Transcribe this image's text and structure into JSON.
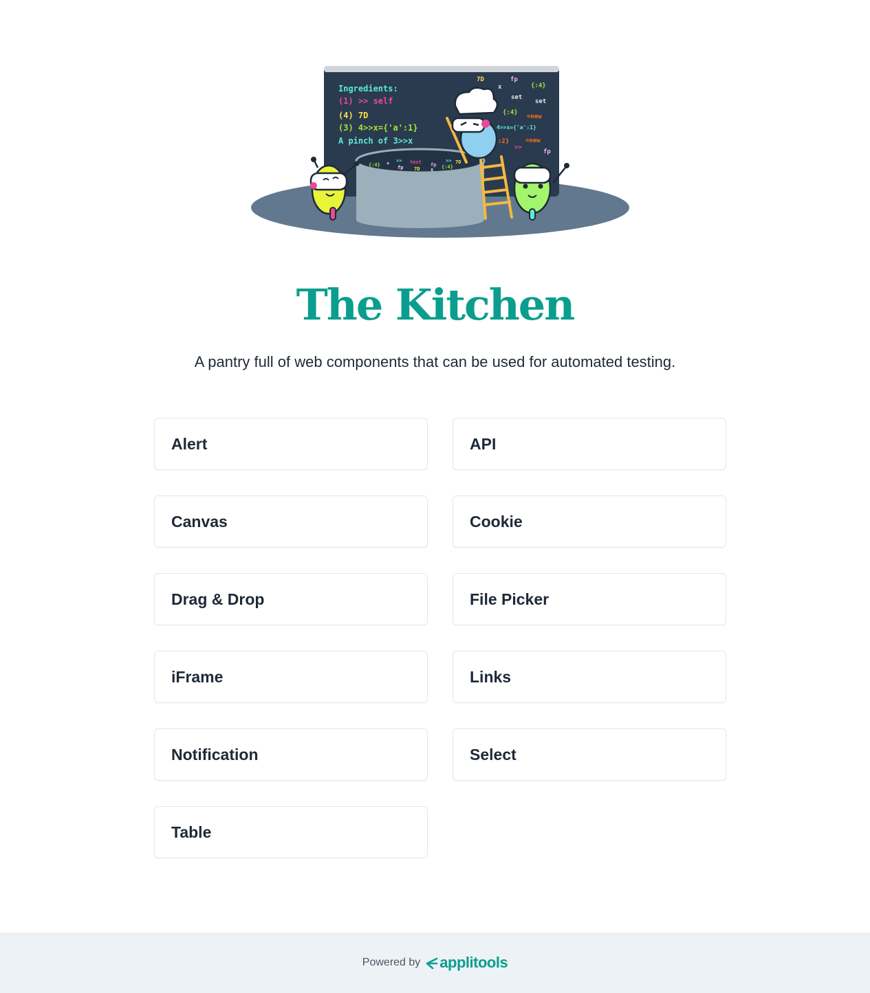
{
  "hero": {
    "illustration": "kitchen-illustration",
    "board": {
      "lines": [
        "Ingredients:",
        "(1) >> self",
        "(4) 7D",
        "(3) 4>>x={'a':1}",
        "A pinch of 3>>x"
      ],
      "scattered": [
        "7D",
        "fp",
        "x",
        "{:4}",
        "set",
        "set",
        "{:4}",
        "=new",
        "4>>x={'a':1}",
        ":2}",
        "=new",
        ">>",
        "fp"
      ]
    },
    "pot_text": [
      "{:4}",
      "+",
      ">>",
      "test",
      "fp",
      ">>",
      "7D",
      "fp",
      "7D",
      "x",
      "{:4}",
      "x"
    ]
  },
  "title": "The Kitchen",
  "subtitle": "A pantry full of web components that can be used for automated testing.",
  "components": [
    {
      "label": "Alert"
    },
    {
      "label": "API"
    },
    {
      "label": "Canvas"
    },
    {
      "label": "Cookie"
    },
    {
      "label": "Drag & Drop"
    },
    {
      "label": "File Picker"
    },
    {
      "label": "iFrame"
    },
    {
      "label": "Links"
    },
    {
      "label": "Notification"
    },
    {
      "label": "Select"
    },
    {
      "label": "Table"
    }
  ],
  "footer": {
    "powered_by": "Powered by",
    "brand": "applitools",
    "brand_icon": "applitools-logo-icon"
  },
  "colors": {
    "accent": "#0b9e8e",
    "board": "#2a3b4f",
    "floor": "#62788f",
    "footer_bg": "#edf2f6"
  }
}
